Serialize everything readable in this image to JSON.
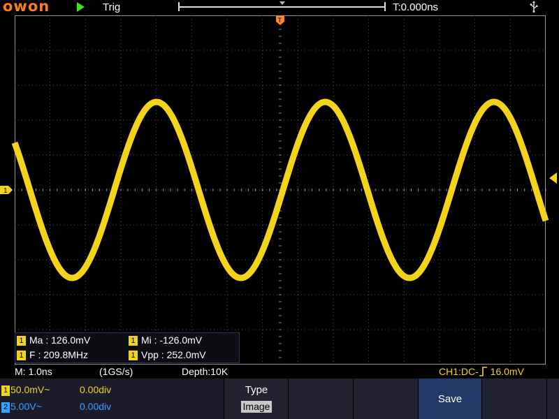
{
  "header": {
    "logo_text": "owon",
    "run_state_icon": "play-icon",
    "trigger_status": "Trig",
    "time_offset": "T:0.000ns",
    "usb_icon": "usb-icon"
  },
  "screen": {
    "trigger_marker": "T",
    "channel_marker": "1",
    "waveform": {
      "channel": "CH1",
      "color": "#f3d41a",
      "frequency_mhz": 209.8,
      "amplitude_mv": 126.0,
      "volts_per_div_mv": 50.0
    }
  },
  "measurements": {
    "max": {
      "channel": "1",
      "text": "Ma : 126.0mV"
    },
    "min": {
      "channel": "1",
      "text": "Mi : -126.0mV"
    },
    "freq": {
      "channel": "1",
      "text": "F : 209.8MHz"
    },
    "vpp": {
      "channel": "1",
      "text": "Vpp : 252.0mV"
    }
  },
  "status": {
    "timebase": "M: 1.0ns",
    "sample_rate": "(1GS/s)",
    "depth": "Depth:10K",
    "trigger_prefix": "CH1:DC-",
    "trigger_level": "16.0mV"
  },
  "channels": [
    {
      "num": "1",
      "scale": "50.0mV~",
      "offset": "0.00div",
      "color": "#f3d41a"
    },
    {
      "num": "2",
      "scale": "5.00V~",
      "offset": "0.00div",
      "color": "#3aa0ff"
    }
  ],
  "menu": {
    "type_label": "Type",
    "type_value": "Image",
    "save_label": "Save"
  },
  "colors": {
    "ch1": "#f3d41a",
    "ch2": "#3aa0ff",
    "logo": "#ff7a1a",
    "run": "#39e81c",
    "save_button": "#1f3a66"
  }
}
